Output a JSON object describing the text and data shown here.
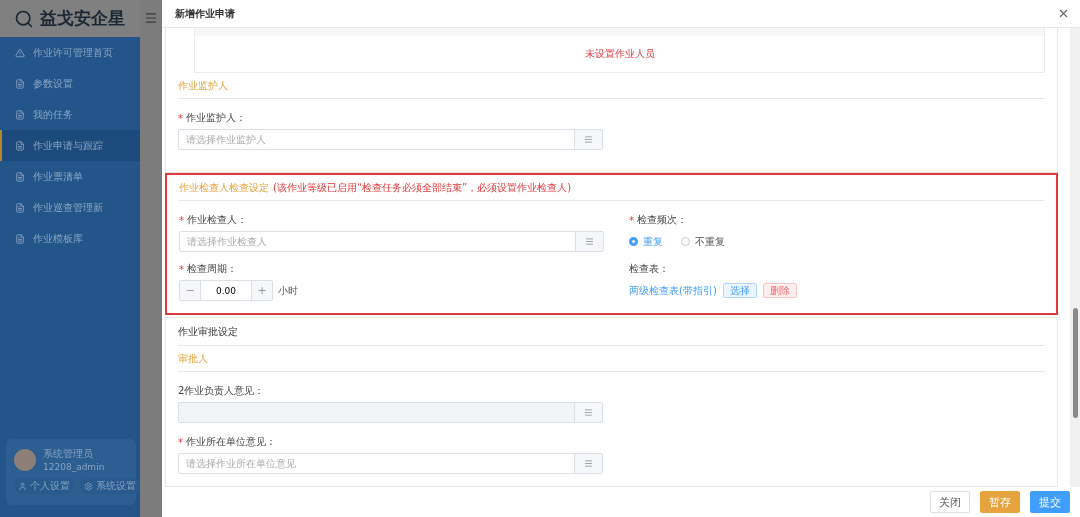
{
  "sidebar": {
    "logo": "益戈安企星",
    "items": [
      {
        "label": "作业许可管理首页",
        "kind": "warning",
        "selected": false
      },
      {
        "label": "参数设置",
        "kind": "doc",
        "selected": false
      },
      {
        "label": "我的任务",
        "kind": "doc",
        "selected": false
      },
      {
        "label": "作业申请与跟踪",
        "kind": "doc",
        "selected": true
      },
      {
        "label": "作业票清单",
        "kind": "doc",
        "selected": false
      },
      {
        "label": "作业巡查管理新",
        "kind": "doc",
        "selected": false
      },
      {
        "label": "作业模板库",
        "kind": "doc",
        "selected": false
      }
    ],
    "user": {
      "name": "系统管理员",
      "id": "12208_admin",
      "actions": [
        {
          "label": "个人设置",
          "kind": "person"
        },
        {
          "label": "系统设置",
          "kind": "gear"
        }
      ]
    }
  },
  "dialog": {
    "title": "新增作业申请",
    "workers": {
      "empty_text": "未设置作业人员"
    },
    "guardian": {
      "section": "作业监护人",
      "field": {
        "label": "作业监护人：",
        "required_mark": "*",
        "placeholder": "请选择作业监护人",
        "disabled": false
      }
    },
    "inspection": {
      "section": "作业检查人检查设定",
      "note": "(该作业等级已启用“检查任务必须全部结束”，必须设置作业检查人)",
      "inspector": {
        "label": "作业检查人：",
        "required_mark": "*",
        "placeholder": "请选择作业检查人",
        "disabled": false
      },
      "period": {
        "label": "检查周期：",
        "required_mark": "*",
        "minus": "−",
        "value": "0.00",
        "plus": "+",
        "unit": "小时"
      },
      "frequency": {
        "label": "检查频次：",
        "required_mark": "*",
        "options": [
          {
            "label": "重复",
            "selected": true
          },
          {
            "label": "不重复",
            "selected": false
          }
        ]
      },
      "checklist": {
        "label": "检查表：",
        "link": "两级检查表(带指引)",
        "buttons": [
          {
            "label": "选择",
            "kind": "primary"
          },
          {
            "label": "删除",
            "kind": "danger"
          }
        ]
      }
    },
    "approval": {
      "title": "作业审批设定",
      "section": "审批人",
      "fields": [
        {
          "label": "2作业负责人意见：",
          "disabled": true
        },
        {
          "label": "作业所在单位意见：",
          "required_mark": "*",
          "placeholder": "请选择作业所在单位意见",
          "disabled": false
        }
      ]
    },
    "footer": [
      {
        "label": "关闭",
        "kind": "default"
      },
      {
        "label": "暂存",
        "kind": "warning"
      },
      {
        "label": "提交",
        "kind": "primary"
      }
    ]
  }
}
